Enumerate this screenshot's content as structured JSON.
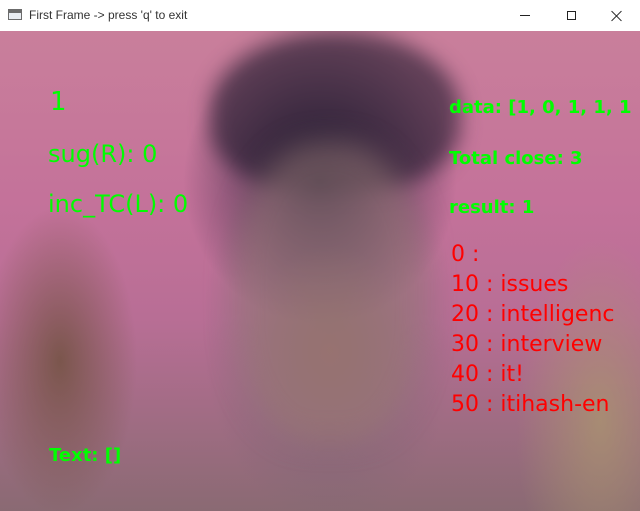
{
  "window": {
    "title": "First Frame -> press 'q' to exit"
  },
  "overlay": {
    "count": "1",
    "suggestion_right": "sug(R): 0",
    "increment_left": "inc_TC(L): 0",
    "data": "data: [1, 0, 1, 1, 1",
    "total_close": "Total close: 3",
    "result": "result: 1",
    "text": "Text: []",
    "suggestions": [
      "0 :",
      "10 : issues",
      "20 : intelligenc",
      "30 : interview",
      "40 : it!",
      "50 : itihash-en"
    ]
  },
  "colors": {
    "overlay_green": "#00ff00",
    "overlay_red": "#ff0000"
  },
  "icons": {
    "app": "window-app-icon",
    "minimize": "minimize-icon",
    "maximize": "maximize-icon",
    "close": "close-icon"
  }
}
